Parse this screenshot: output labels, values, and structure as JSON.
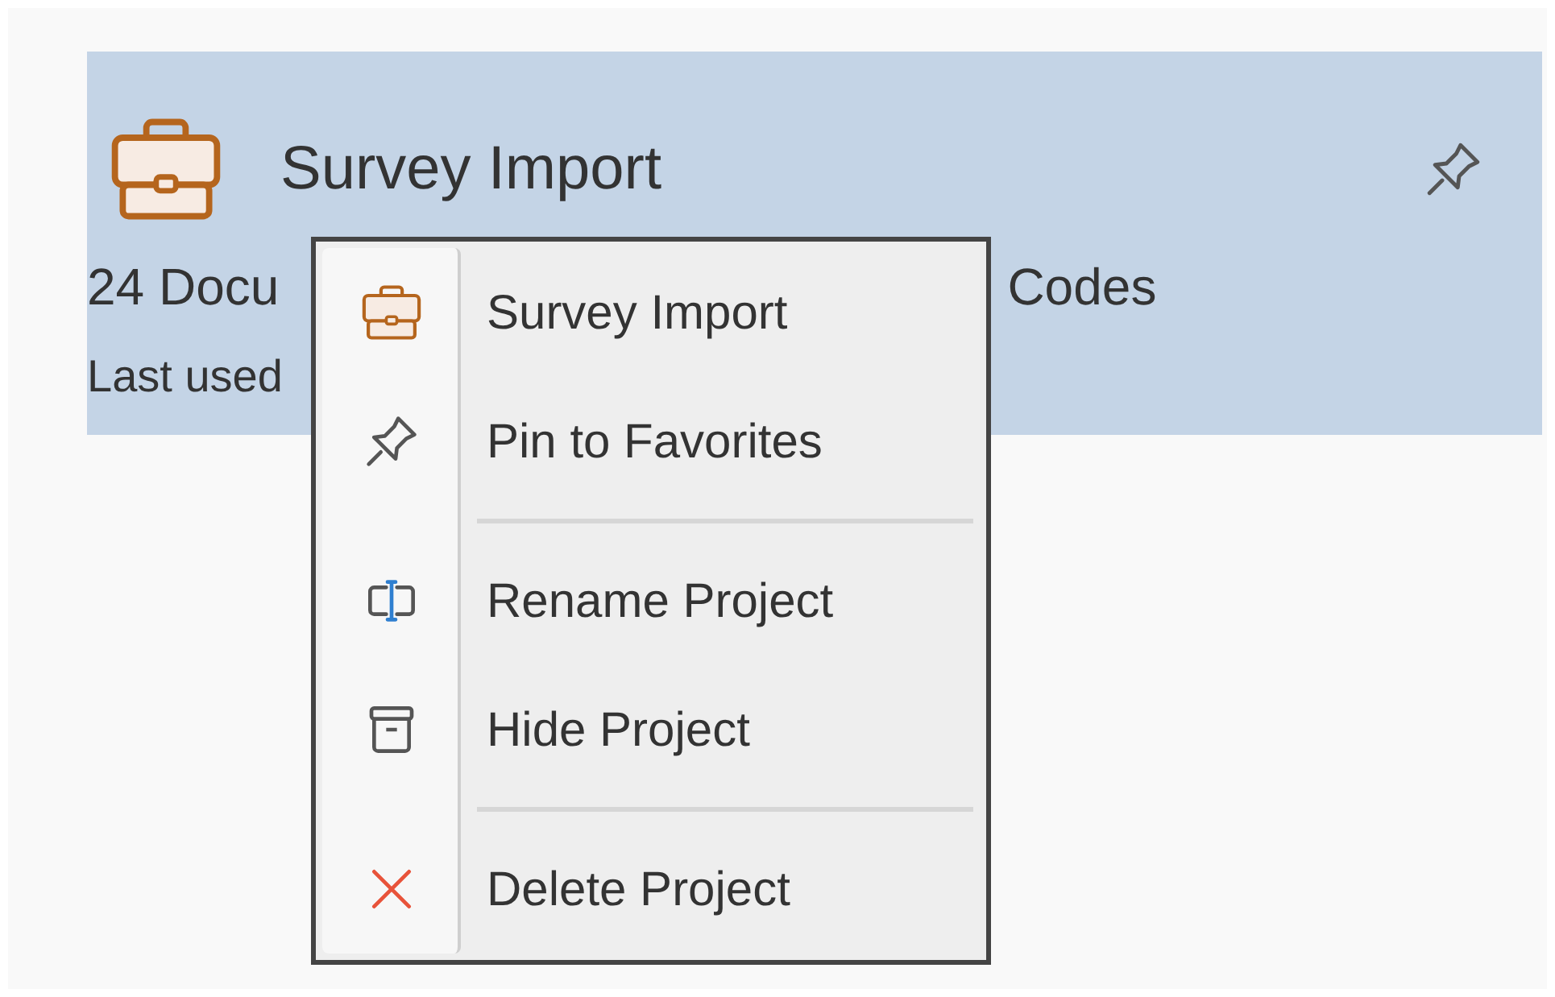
{
  "project_card": {
    "title": "Survey Import",
    "selected": true,
    "stats_start": "24 Docu",
    "stats_end": "Codes",
    "last_used": "Last used"
  },
  "context_menu": {
    "groups": [
      [
        {
          "label": "Survey Import"
        },
        {
          "label": "Pin to Favorites"
        }
      ],
      [
        {
          "label": "Rename Project"
        },
        {
          "label": "Hide Project"
        }
      ],
      [
        {
          "label": "Delete Project"
        }
      ]
    ]
  }
}
